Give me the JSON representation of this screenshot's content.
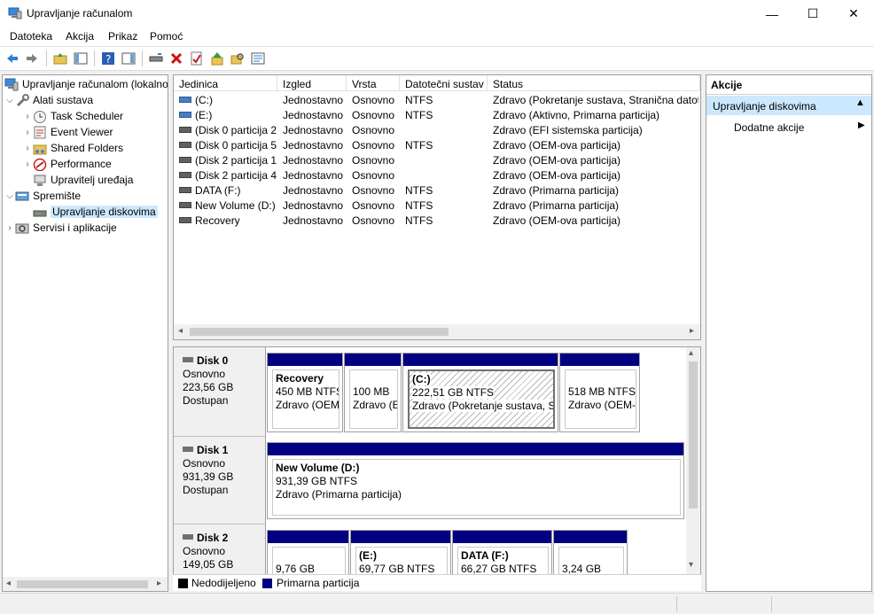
{
  "window": {
    "title": "Upravljanje računalom",
    "minimize_icon": "—",
    "maximize_icon": "☐",
    "close_icon": "✕"
  },
  "menu": [
    "Datoteka",
    "Akcija",
    "Prikaz",
    "Pomoć"
  ],
  "tree": {
    "root": "Upravljanje računalom (lokalno)",
    "system_tools": "Alati sustava",
    "task_scheduler": "Task Scheduler",
    "event_viewer": "Event Viewer",
    "shared_folders": "Shared Folders",
    "performance": "Performance",
    "device_manager": "Upravitelj uređaja",
    "storage": "Spremište",
    "disk_management": "Upravljanje diskovima",
    "services": "Servisi i aplikacije"
  },
  "volume_list": {
    "headers": [
      "Jedinica",
      "Izgled",
      "Vrsta",
      "Datotečni sustav",
      "Status"
    ],
    "rows": [
      [
        "(C:)",
        "Jednostavno",
        "Osnovno",
        "NTFS",
        "Zdravo (Pokretanje sustava, Stranična datoteka"
      ],
      [
        "(E:)",
        "Jednostavno",
        "Osnovno",
        "NTFS",
        "Zdravo (Aktivno, Primarna particija)"
      ],
      [
        "(Disk 0 particija 2)",
        "Jednostavno",
        "Osnovno",
        "",
        "Zdravo (EFI sistemska particija)"
      ],
      [
        "(Disk 0 particija 5)",
        "Jednostavno",
        "Osnovno",
        "NTFS",
        "Zdravo (OEM-ova particija)"
      ],
      [
        "(Disk 2 particija 1)",
        "Jednostavno",
        "Osnovno",
        "",
        "Zdravo (OEM-ova particija)"
      ],
      [
        "(Disk 2 particija 4)",
        "Jednostavno",
        "Osnovno",
        "",
        "Zdravo (OEM-ova particija)"
      ],
      [
        "DATA (F:)",
        "Jednostavno",
        "Osnovno",
        "NTFS",
        "Zdravo (Primarna particija)"
      ],
      [
        "New Volume (D:)",
        "Jednostavno",
        "Osnovno",
        "NTFS",
        "Zdravo (Primarna particija)"
      ],
      [
        "Recovery",
        "Jednostavno",
        "Osnovno",
        "NTFS",
        "Zdravo (OEM-ova particija)"
      ]
    ]
  },
  "disks": {
    "disk0": {
      "name": "Disk 0",
      "type": "Osnovno",
      "size": "223,56 GB",
      "status": "Dostupan",
      "p1": {
        "name": "Recovery",
        "size": "450 MB NTFS",
        "status": "Zdravo (OEM"
      },
      "p2": {
        "size": "100 MB",
        "status": "Zdravo (E"
      },
      "p3": {
        "name": "(C:)",
        "size": "222,51 GB NTFS",
        "status": "Zdravo (Pokretanje sustava, Str"
      },
      "p4": {
        "size": "518 MB NTFS",
        "status": "Zdravo (OEM-"
      }
    },
    "disk1": {
      "name": "Disk 1",
      "type": "Osnovno",
      "size": "931,39 GB",
      "status": "Dostupan",
      "p1": {
        "name": "New Volume  (D:)",
        "size": "931,39 GB NTFS",
        "status": "Zdravo (Primarna particija)"
      }
    },
    "disk2": {
      "name": "Disk 2",
      "type": "Osnovno",
      "size": "149,05 GB",
      "p1": {
        "size": "9,76 GB"
      },
      "p2": {
        "name": "(E:)",
        "size": "69,77 GB NTFS"
      },
      "p3": {
        "name": "DATA  (F:)",
        "size": "66,27 GB NTFS"
      },
      "p4": {
        "size": "3,24 GB"
      }
    }
  },
  "legend": {
    "unallocated": "Nedodijeljeno",
    "primary": "Primarna particija",
    "unallocated_color": "#000000",
    "primary_color": "#000080"
  },
  "actions": {
    "header": "Akcije",
    "selected": "Upravljanje diskovima",
    "more": "Dodatne akcije"
  },
  "colors": {
    "selection": "#cce8ff",
    "partition_bar": "#000080",
    "actions_selected_bg": "#cce8ff"
  }
}
